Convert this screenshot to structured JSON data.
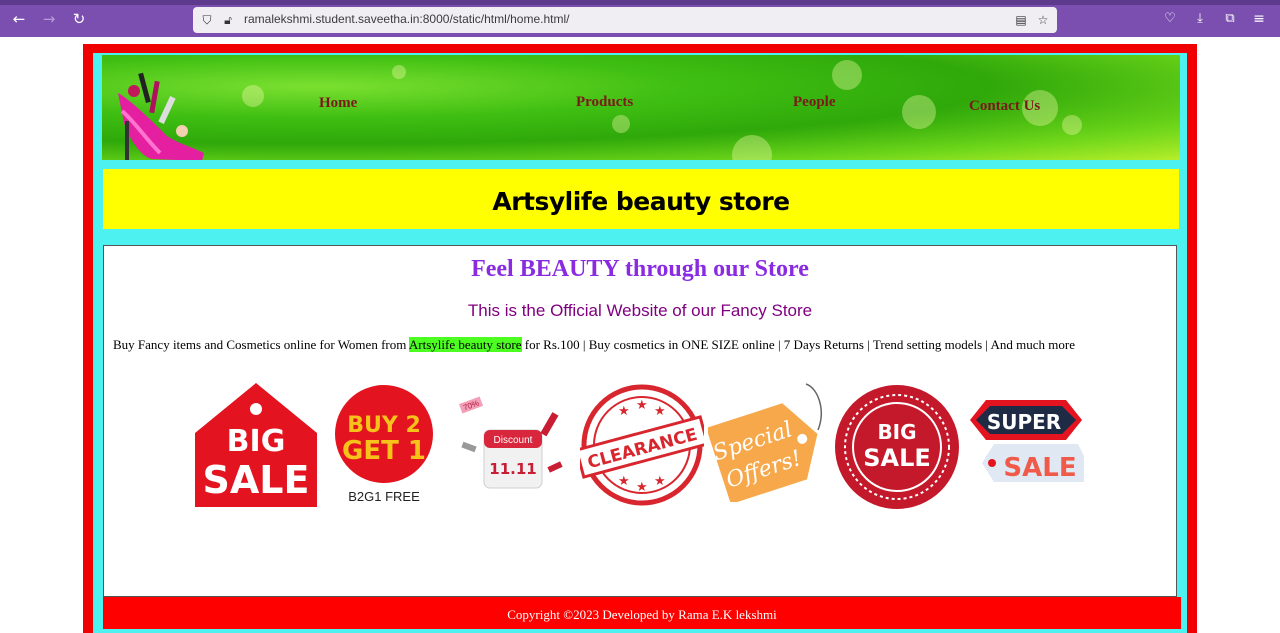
{
  "browser": {
    "url": "ramalekshmi.student.saveetha.in:8000/static/html/home.html/",
    "back_icon": "arrow-left-icon",
    "forward_icon": "arrow-right-icon",
    "reload_icon": "reload-icon"
  },
  "nav": {
    "home": "Home",
    "products": "Products",
    "people": "People",
    "contact": "Contact Us"
  },
  "store_title": "Artsylife beauty store",
  "main": {
    "headline": "Feel BEAUTY through our Store",
    "subline": "This is the Official Website of our Fancy Store",
    "desc_before": "Buy Fancy items and Cosmetics online for Women from ",
    "desc_highlight": "Artsylife beauty store",
    "desc_after": " for Rs.100 | Buy cosmetics in ONE SIZE online | 7 Days Returns | Trend setting models | And much more"
  },
  "badges": {
    "big_sale_1": "BIG",
    "big_sale_2": "SALE",
    "b2g1_1": "BUY 2",
    "b2g1_2": "GET 1",
    "b2g1_caption": "B2G1 FREE",
    "discount_label": "Discount",
    "discount_date": "11.11",
    "discount_pct": "70%",
    "clearance": "CLEARANCE",
    "special_1": "Special",
    "special_2": "Offers!",
    "big_sale2_1": "BIG",
    "big_sale2_2": "SALE",
    "super_1": "SUPER",
    "super_2": "SALE"
  },
  "footer": {
    "copyright": "Copyright ©2023 Developed by Rama E.K lekshmi"
  },
  "colors": {
    "frame_red": "#f00000",
    "frame_cyan": "#4df2f0",
    "title_bg": "#ffff00",
    "headline": "#8a2be2",
    "nav_link": "#7a1a1a",
    "highlight": "#4cff21",
    "footer_bg": "#ff0000"
  }
}
